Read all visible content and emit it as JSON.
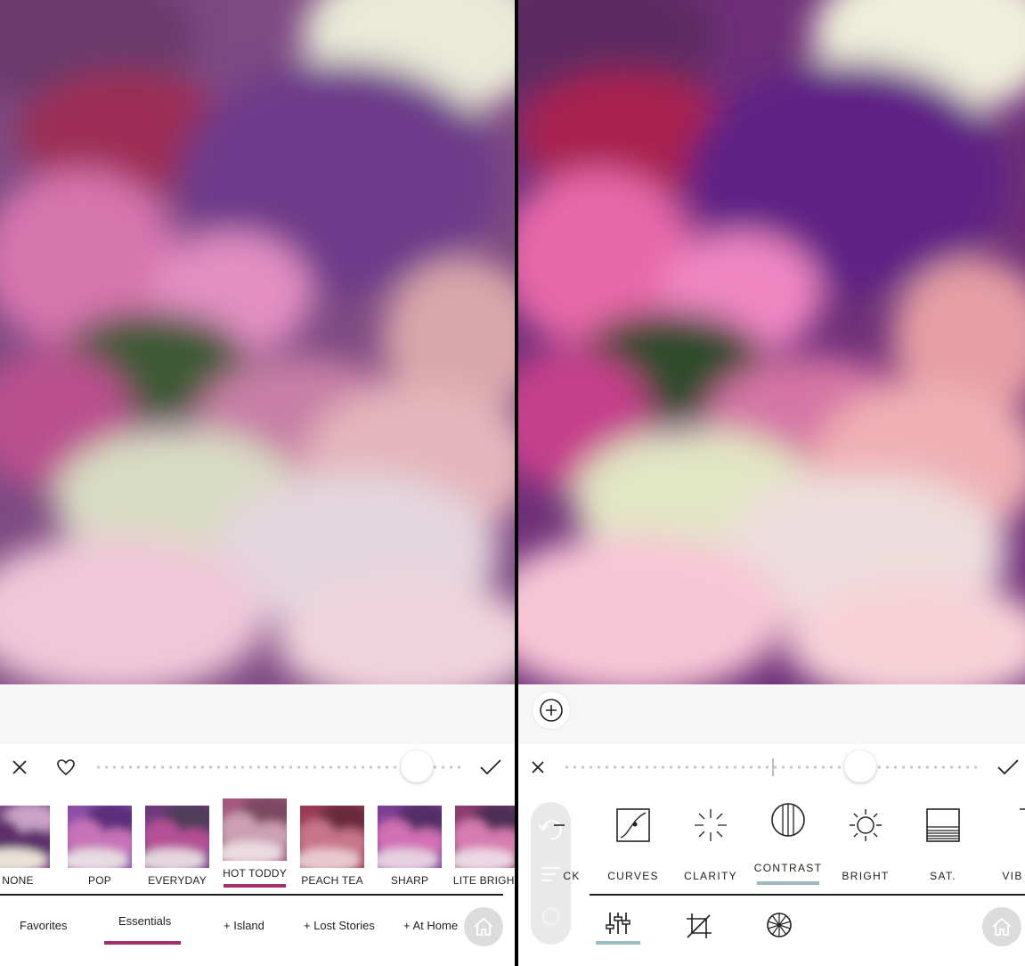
{
  "left": {
    "filters": [
      {
        "label": "NONE"
      },
      {
        "label": "POP"
      },
      {
        "label": "EVERYDAY"
      },
      {
        "label": "HOT TODDY",
        "selected": true
      },
      {
        "label": "PEACH TEA"
      },
      {
        "label": "SHARP"
      },
      {
        "label": "LITE BRIGHT"
      }
    ],
    "categories": [
      "Favorites",
      "Essentials",
      "+ Island",
      "+ Lost Stories",
      "+ At Home"
    ],
    "selected_category": "Essentials",
    "filter_strength": 0.87
  },
  "right": {
    "tools": [
      {
        "label": "CK"
      },
      {
        "label": "CURVES"
      },
      {
        "label": "CLARITY"
      },
      {
        "label": "CONTRAST",
        "selected": true
      },
      {
        "label": "BRIGHT"
      },
      {
        "label": "SAT."
      },
      {
        "label": "VIB"
      }
    ],
    "adjust_value": 0.71
  },
  "colors": {
    "filter_accent": "#a5306d",
    "tool_accent": "#9dbcc1"
  }
}
